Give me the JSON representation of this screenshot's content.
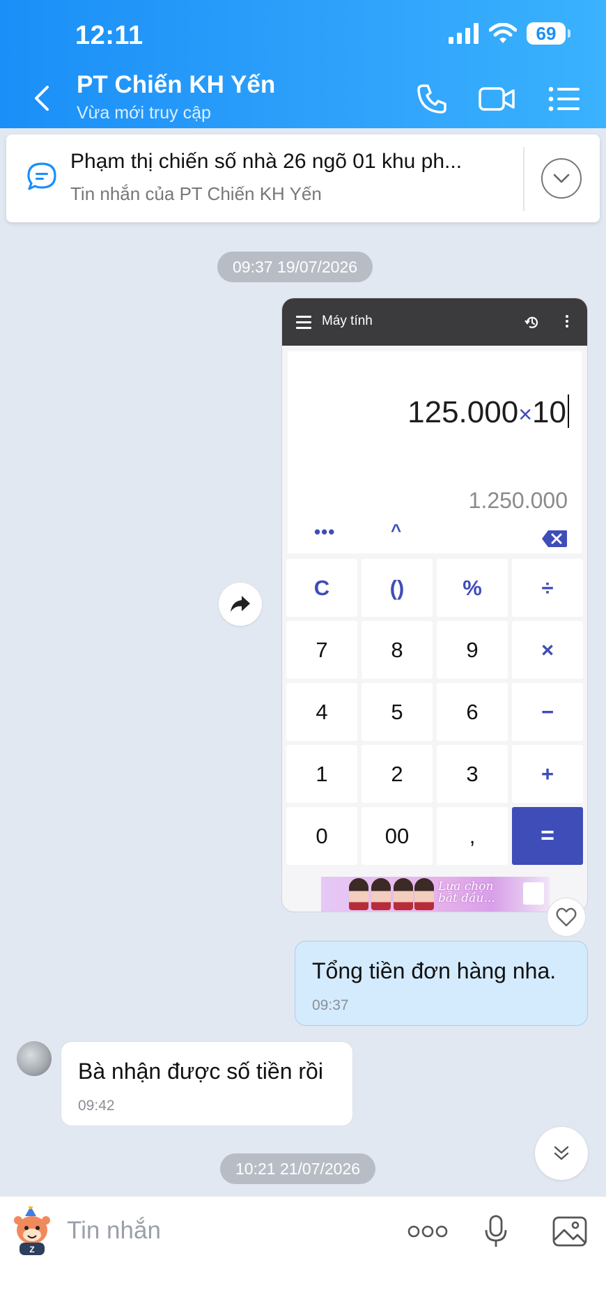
{
  "status_bar": {
    "time": "12:11",
    "battery": "69"
  },
  "header": {
    "contact_name": "PT Chiến KH Yến",
    "contact_status": "Vừa mới truy cập",
    "icons": [
      "back-icon",
      "phone-icon",
      "video-call-icon",
      "list-menu-icon"
    ]
  },
  "pinned": {
    "title": "Phạm thị chiến  số nhà 26  ngõ  01 khu ph...",
    "subtitle": "Tin nhắn của PT Chiến KH Yến"
  },
  "chat": {
    "timestamp_1": "09:37 19/07/2026",
    "image_message": {
      "app_title": "Máy tính",
      "expression_left": "125.000",
      "expression_op": "×",
      "expression_right": "10",
      "result": "1.250.000",
      "tool_ellipsis": "•••",
      "tool_caret": "^",
      "keys": [
        "C",
        "()",
        "%",
        "÷",
        "7",
        "8",
        "9",
        "×",
        "4",
        "5",
        "6",
        "−",
        "1",
        "2",
        "3",
        "+",
        "0",
        "00",
        ",",
        "="
      ],
      "ad_text_line1": "Lựa chọn",
      "ad_text_line2": "bắt đầu..."
    },
    "outgoing_message": {
      "text": "Tổng tiền đơn hàng nha.",
      "time": "09:37"
    },
    "incoming_message": {
      "text": "Bà nhận được số tiền rồi",
      "time": "09:42"
    },
    "timestamp_2": "10:21 21/07/2026"
  },
  "input_bar": {
    "placeholder": "Tin nhắn",
    "icons": [
      "sticker-icon",
      "more-options-icon",
      "microphone-icon",
      "image-icon"
    ]
  },
  "colors": {
    "header_start": "#1a8ff7",
    "header_end": "#3ab2fd",
    "chat_background": "#e2e8f1",
    "outgoing_bubble": "#d4ebfd",
    "calculator_accent": "#3f4db8"
  }
}
